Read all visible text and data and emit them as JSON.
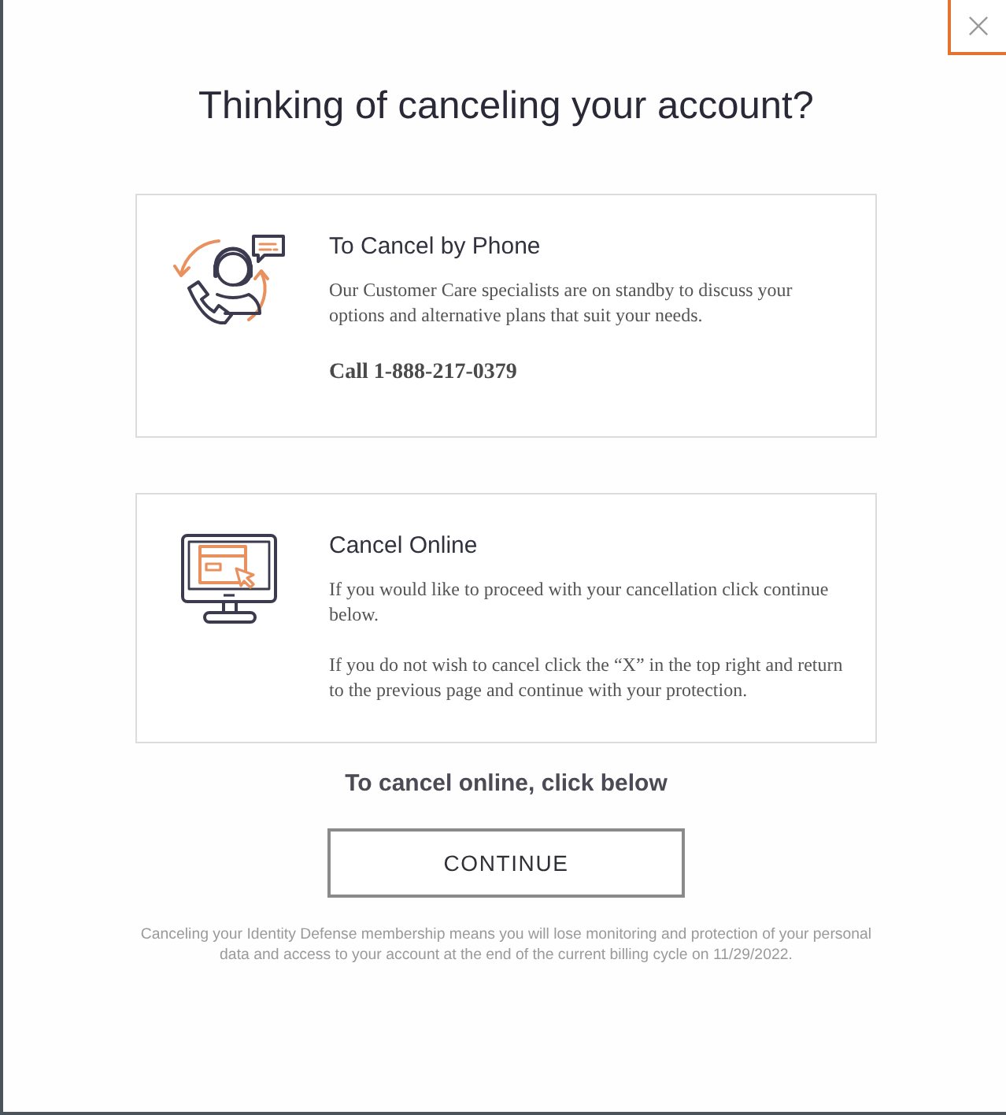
{
  "dialog": {
    "title": "Thinking of canceling your account?"
  },
  "options": [
    {
      "kind": "phone",
      "heading": "To Cancel by Phone",
      "paragraphs": [
        "Our Customer Care specialists are on standby to discuss your options and alternative plans that suit your needs."
      ],
      "call": "Call 1-888-217-0379"
    },
    {
      "kind": "online",
      "heading": "Cancel Online",
      "paragraphs": [
        "If you would like to proceed with your cancellation click continue below.",
        "If you do not wish to cancel click the “X” in the top right and return to the previous page and continue with your protection."
      ]
    }
  ],
  "prompt": "To cancel online, click below",
  "continue_button": {
    "label": "CONTINUE"
  },
  "disclaimer": "Canceling your Identity Defense membership means you will lose monitoring and protection of your personal data and access to your account at the end of the current billing cycle on 11/29/2022."
}
